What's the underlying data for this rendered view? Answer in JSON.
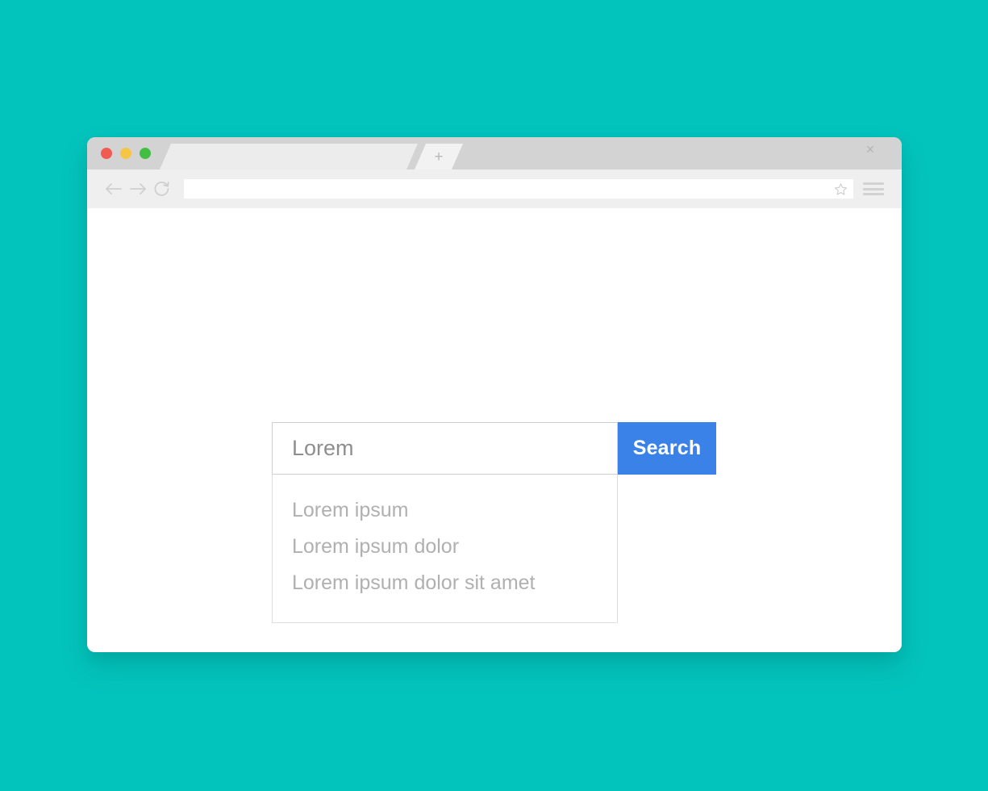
{
  "background": {
    "color": "#03c4bc"
  },
  "browser": {
    "window_controls": [
      {
        "name": "close",
        "color": "#f15b52"
      },
      {
        "name": "minimize",
        "color": "#f6c544"
      },
      {
        "name": "maximize",
        "color": "#42bf43"
      }
    ],
    "tabs": [
      {
        "label": "",
        "active": true,
        "close_glyph": "×"
      }
    ],
    "new_tab_glyph": "+",
    "toolbar": {
      "back_icon": "arrow-left-icon",
      "forward_icon": "arrow-right-icon",
      "reload_icon": "reload-icon",
      "address_value": "",
      "address_placeholder": "",
      "bookmark_icon": "star-icon",
      "menu_icon": "hamburger-menu-icon"
    }
  },
  "search": {
    "input_value": "Lorem",
    "input_placeholder": "Lorem",
    "button_label": "Search",
    "button_color": "#3b82e8",
    "suggestions": [
      {
        "label": "Lorem ipsum"
      },
      {
        "label": "Lorem ipsum dolor"
      },
      {
        "label": "Lorem ipsum dolor sit amet"
      }
    ]
  }
}
